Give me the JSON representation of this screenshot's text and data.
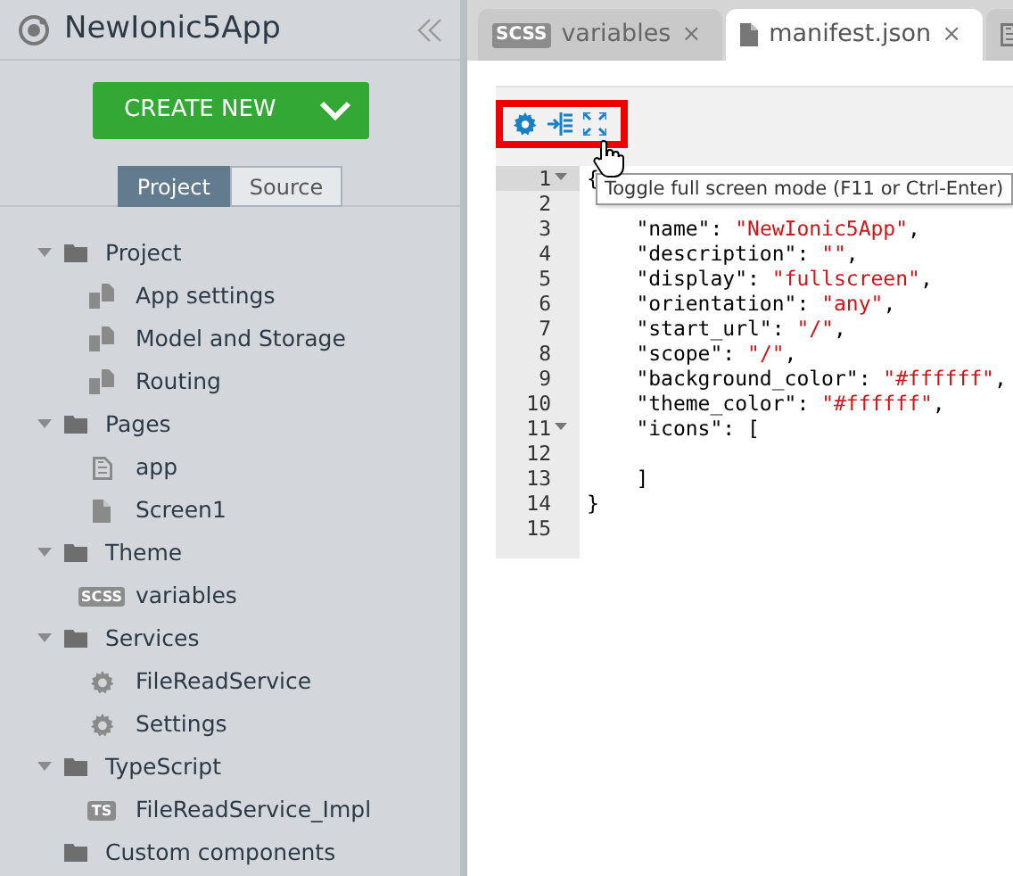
{
  "app": {
    "title": "NewIonic5App"
  },
  "create_button": {
    "label": "CREATE NEW"
  },
  "view_toggle": [
    {
      "label": "Project",
      "selected": true
    },
    {
      "label": "Source",
      "selected": false
    }
  ],
  "tree": [
    {
      "kind": "folder",
      "label": "Project",
      "expanded": true,
      "children": [
        {
          "kind": "config",
          "label": "App settings"
        },
        {
          "kind": "config",
          "label": "Model and Storage"
        },
        {
          "kind": "config",
          "label": "Routing"
        }
      ]
    },
    {
      "kind": "folder",
      "label": "Pages",
      "expanded": true,
      "children": [
        {
          "kind": "page-outline",
          "label": "app"
        },
        {
          "kind": "page",
          "label": "Screen1"
        }
      ]
    },
    {
      "kind": "folder",
      "label": "Theme",
      "expanded": true,
      "children": [
        {
          "kind": "scss",
          "badge": "SCSS",
          "label": "variables"
        }
      ]
    },
    {
      "kind": "folder",
      "label": "Services",
      "expanded": true,
      "children": [
        {
          "kind": "gear",
          "label": "FileReadService"
        },
        {
          "kind": "gear",
          "label": "Settings"
        }
      ]
    },
    {
      "kind": "folder",
      "label": "TypeScript",
      "expanded": true,
      "children": [
        {
          "kind": "ts",
          "badge": "TS",
          "label": "FileReadService_Impl"
        }
      ]
    },
    {
      "kind": "folder",
      "label": "Custom components",
      "expanded": false
    }
  ],
  "tabs": [
    {
      "kind": "scss",
      "badge": "SCSS",
      "label": "variables",
      "close": "×",
      "selected": false
    },
    {
      "kind": "page",
      "label": "manifest.json",
      "close": "×",
      "selected": true
    },
    {
      "kind": "page-outline",
      "selected": false
    }
  ],
  "tooltip": "Toggle full screen mode (F11 or Ctrl-Enter)",
  "code_lines": [
    {
      "number": "1",
      "foldable": true,
      "current": true,
      "parts": [
        {
          "kind": "punct",
          "text": "{"
        }
      ]
    },
    {
      "number": "2",
      "foldable": false,
      "current": false
    },
    {
      "number": "3",
      "foldable": false,
      "current": false,
      "parts": [
        {
          "kind": "key",
          "text": "    \"name\": "
        },
        {
          "kind": "string",
          "text": "\"NewIonic5App\""
        },
        {
          "kind": "punct",
          "text": ","
        }
      ]
    },
    {
      "number": "4",
      "foldable": false,
      "current": false,
      "parts": [
        {
          "kind": "key",
          "text": "    \"description\": "
        },
        {
          "kind": "string",
          "text": "\"\""
        },
        {
          "kind": "punct",
          "text": ","
        }
      ]
    },
    {
      "number": "5",
      "foldable": false,
      "current": false,
      "parts": [
        {
          "kind": "key",
          "text": "    \"display\": "
        },
        {
          "kind": "string",
          "text": "\"fullscreen\""
        },
        {
          "kind": "punct",
          "text": ","
        }
      ]
    },
    {
      "number": "6",
      "foldable": false,
      "current": false,
      "parts": [
        {
          "kind": "key",
          "text": "    \"orientation\": "
        },
        {
          "kind": "string",
          "text": "\"any\""
        },
        {
          "kind": "punct",
          "text": ","
        }
      ]
    },
    {
      "number": "7",
      "foldable": false,
      "current": false,
      "parts": [
        {
          "kind": "key",
          "text": "    \"start_url\": "
        },
        {
          "kind": "string",
          "text": "\"/\""
        },
        {
          "kind": "punct",
          "text": ","
        }
      ]
    },
    {
      "number": "8",
      "foldable": false,
      "current": false,
      "parts": [
        {
          "kind": "key",
          "text": "    \"scope\": "
        },
        {
          "kind": "string",
          "text": "\"/\""
        },
        {
          "kind": "punct",
          "text": ","
        }
      ]
    },
    {
      "number": "9",
      "foldable": false,
      "current": false,
      "parts": [
        {
          "kind": "key",
          "text": "    \"background_color\": "
        },
        {
          "kind": "string",
          "text": "\"#ffffff\""
        },
        {
          "kind": "punct",
          "text": ","
        }
      ]
    },
    {
      "number": "10",
      "foldable": false,
      "current": false,
      "parts": [
        {
          "kind": "key",
          "text": "    \"theme_color\": "
        },
        {
          "kind": "string",
          "text": "\"#ffffff\""
        },
        {
          "kind": "punct",
          "text": ","
        }
      ]
    },
    {
      "number": "11",
      "foldable": true,
      "current": false,
      "parts": [
        {
          "kind": "key",
          "text": "    \"icons\": ["
        }
      ]
    },
    {
      "number": "12",
      "foldable": false,
      "current": false
    },
    {
      "number": "13",
      "foldable": false,
      "current": false,
      "parts": [
        {
          "kind": "punct",
          "text": "    ]"
        }
      ]
    },
    {
      "number": "14",
      "foldable": false,
      "current": false,
      "parts": [
        {
          "kind": "punct",
          "text": "}"
        }
      ]
    },
    {
      "number": "15",
      "foldable": false,
      "current": false
    }
  ]
}
